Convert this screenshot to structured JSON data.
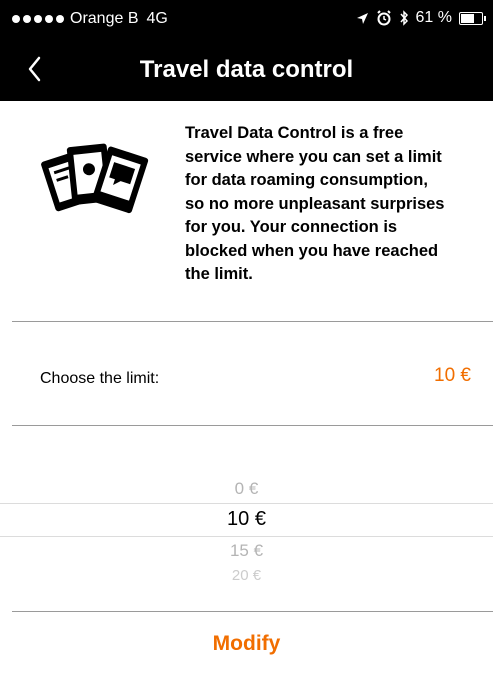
{
  "status": {
    "carrier": "Orange B",
    "network": "4G",
    "battery_percent_label": "61 %",
    "battery_level": 0.61
  },
  "nav": {
    "title": "Travel data control",
    "back_icon": "chevron-left-icon"
  },
  "intro": {
    "icon": "travel-cards-icon",
    "lines": [
      "Travel Data Control is a free",
      "service where you can set a limit",
      "for data roaming consumption,",
      "so no more unpleasant surprises",
      "for you. Your connection is",
      "blocked when you have reached",
      "the limit."
    ]
  },
  "limit": {
    "label": "Choose the limit:",
    "value": "10 €"
  },
  "picker": {
    "options": [
      "0 €",
      "10 €",
      "15 €",
      "20 €"
    ],
    "selected": "10 €"
  },
  "actions": {
    "modify_label": "Modify"
  },
  "colors": {
    "accent": "#f16e00",
    "bar": "#000000"
  }
}
